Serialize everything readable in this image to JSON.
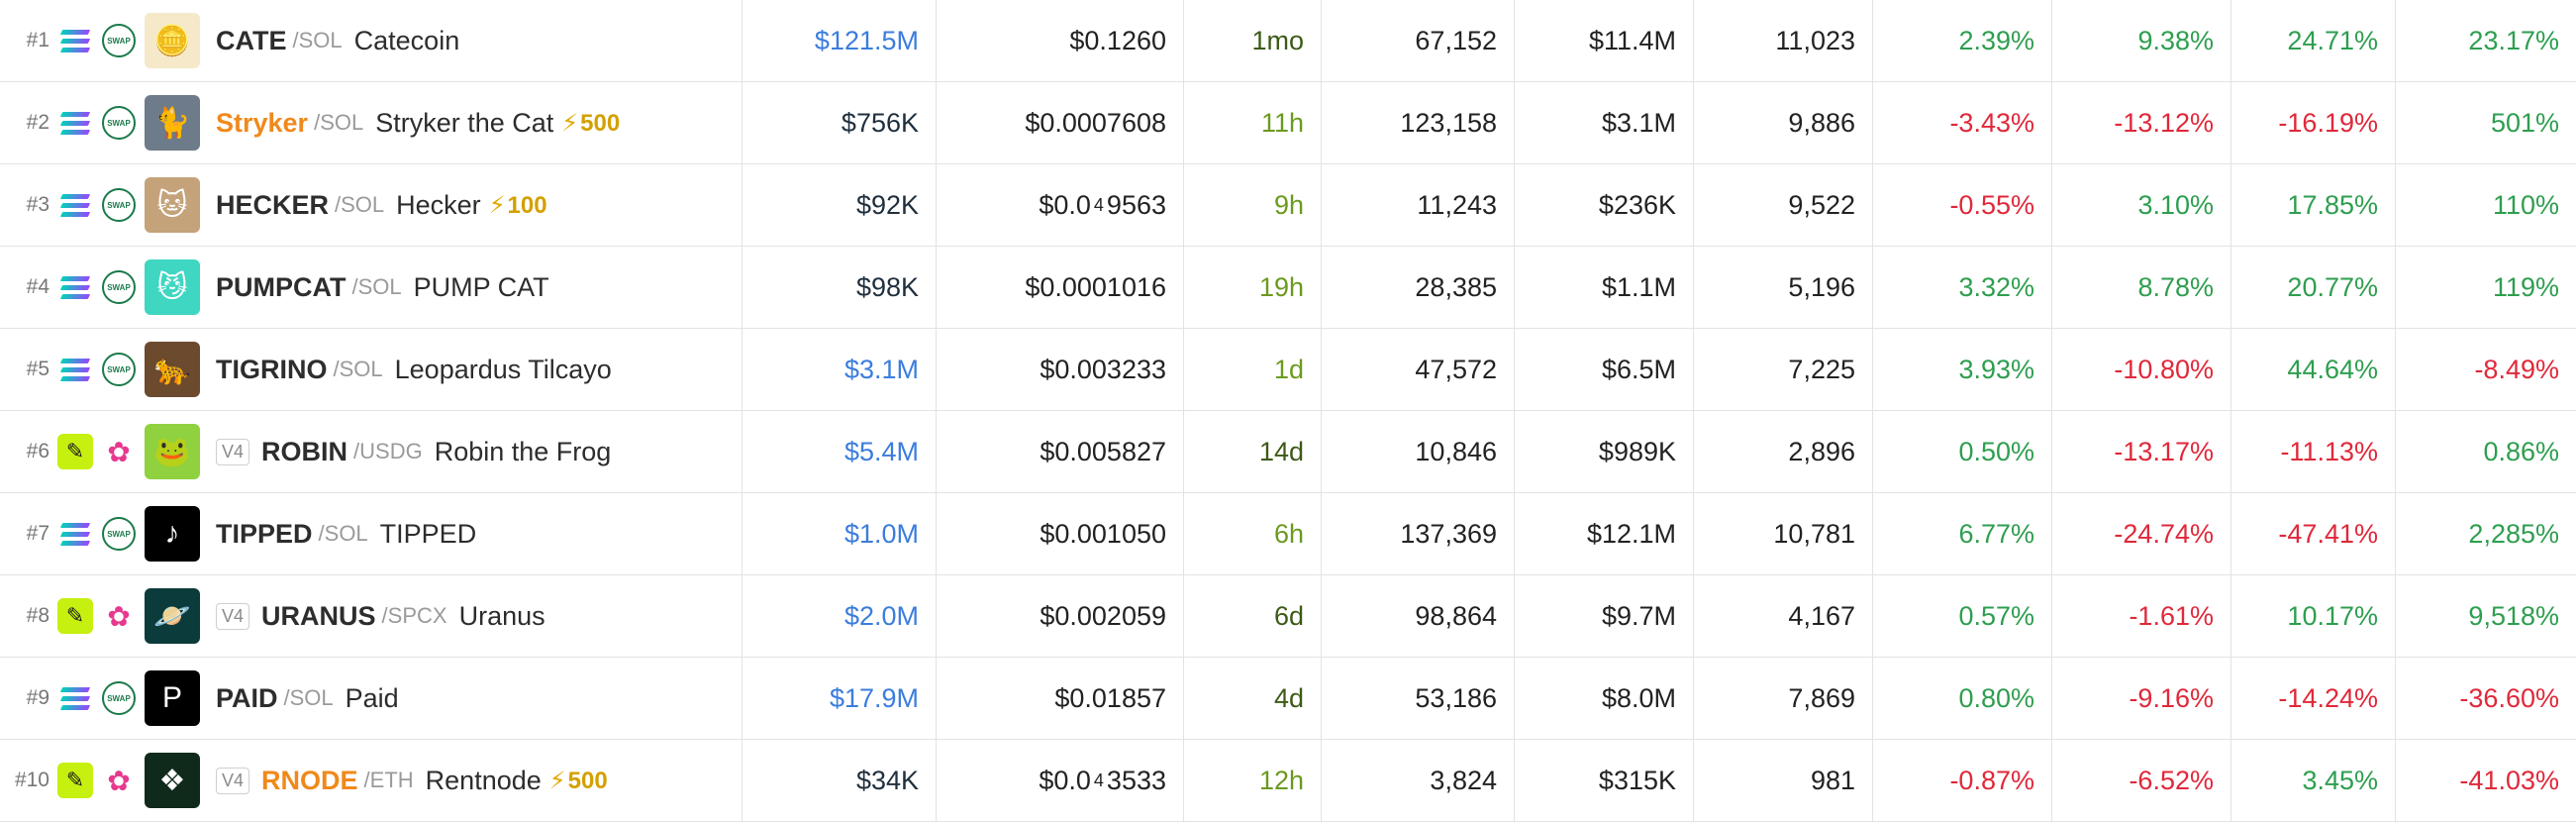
{
  "colors": {
    "up": "#2e9e4f",
    "down": "#e0283a",
    "mcap_blue": "#3b7ddd",
    "mcap_dark": "#1f2f3d",
    "boost": "#d4a000",
    "pump_green": "#c6f00f"
  },
  "rows": [
    {
      "rank": "#1",
      "chain_icon": "solana-icon",
      "dex_icon": "raydium-swap-icon",
      "v4": "",
      "symbol": "CATE",
      "symbol_color": "default",
      "quote": "/SOL",
      "name": "Catecoin",
      "boost": "",
      "mcap": "$121.5M",
      "mcap_color": "blue",
      "price": "$0.1260",
      "price_prefix": "",
      "price_sub": "",
      "price_tail": "",
      "age": "1mo",
      "age_color": "olive-dark",
      "txns": "67,152",
      "volume": "$11.4M",
      "makers": "11,023",
      "p5m": "2.39%",
      "p1h": "9.38%",
      "p6h": "24.71%",
      "p24h": "23.17%",
      "avatar_bg": "#f5e9c9",
      "avatar_glyph": "🪙"
    },
    {
      "rank": "#2",
      "chain_icon": "solana-icon",
      "dex_icon": "raydium-swap-icon",
      "v4": "",
      "symbol": "Stryker",
      "symbol_color": "orange",
      "quote": "/SOL",
      "name": "Stryker the Cat",
      "boost": "500",
      "mcap": "$756K",
      "mcap_color": "dark",
      "price": "$0.0007608",
      "price_prefix": "",
      "price_sub": "",
      "price_tail": "",
      "age": "11h",
      "age_color": "olive",
      "txns": "123,158",
      "volume": "$3.1M",
      "makers": "9,886",
      "p5m": "-3.43%",
      "p1h": "-13.12%",
      "p6h": "-16.19%",
      "p24h": "501%",
      "avatar_bg": "#6d7b8a",
      "avatar_glyph": "🐈"
    },
    {
      "rank": "#3",
      "chain_icon": "solana-icon",
      "dex_icon": "raydium-swap-icon",
      "v4": "",
      "symbol": "HECKER",
      "symbol_color": "default",
      "quote": "/SOL",
      "name": "Hecker",
      "boost": "100",
      "mcap": "$92K",
      "mcap_color": "dark",
      "price": "",
      "price_prefix": "$0.0",
      "price_sub": "4",
      "price_tail": "9563",
      "age": "9h",
      "age_color": "olive",
      "txns": "11,243",
      "volume": "$236K",
      "makers": "9,522",
      "p5m": "-0.55%",
      "p1h": "3.10%",
      "p6h": "17.85%",
      "p24h": "110%",
      "avatar_bg": "#c4a27a",
      "avatar_glyph": "🐱"
    },
    {
      "rank": "#4",
      "chain_icon": "solana-icon",
      "dex_icon": "raydium-swap-icon",
      "v4": "",
      "symbol": "PUMPCAT",
      "symbol_color": "default",
      "quote": "/SOL",
      "name": "PUMP CAT",
      "boost": "",
      "mcap": "$98K",
      "mcap_color": "dark",
      "price": "$0.0001016",
      "price_prefix": "",
      "price_sub": "",
      "price_tail": "",
      "age": "19h",
      "age_color": "olive",
      "txns": "28,385",
      "volume": "$1.1M",
      "makers": "5,196",
      "p5m": "3.32%",
      "p1h": "8.78%",
      "p6h": "20.77%",
      "p24h": "119%",
      "avatar_bg": "#3fd6c2",
      "avatar_glyph": "😼"
    },
    {
      "rank": "#5",
      "chain_icon": "solana-icon",
      "dex_icon": "raydium-swap-icon",
      "v4": "",
      "symbol": "TIGRINO",
      "symbol_color": "default",
      "quote": "/SOL",
      "name": "Leopardus Tilcayo",
      "boost": "",
      "mcap": "$3.1M",
      "mcap_color": "blue",
      "price": "$0.003233",
      "price_prefix": "",
      "price_sub": "",
      "price_tail": "",
      "age": "1d",
      "age_color": "olive",
      "txns": "47,572",
      "volume": "$6.5M",
      "makers": "7,225",
      "p5m": "3.93%",
      "p1h": "-10.80%",
      "p6h": "44.64%",
      "p24h": "-8.49%",
      "avatar_bg": "#6b4a2e",
      "avatar_glyph": "🐆"
    },
    {
      "rank": "#6",
      "chain_icon": "pumpfun-icon",
      "dex_icon": "fox-dex-icon",
      "v4": "V4",
      "symbol": "ROBIN",
      "symbol_color": "default",
      "quote": "/USDG",
      "name": "Robin the Frog",
      "boost": "",
      "mcap": "$5.4M",
      "mcap_color": "blue",
      "price": "$0.005827",
      "price_prefix": "",
      "price_sub": "",
      "price_tail": "",
      "age": "14d",
      "age_color": "olive-dark",
      "txns": "10,846",
      "volume": "$989K",
      "makers": "2,896",
      "p5m": "0.50%",
      "p1h": "-13.17%",
      "p6h": "-11.13%",
      "p24h": "0.86%",
      "avatar_bg": "#8fd13f",
      "avatar_glyph": "🐸"
    },
    {
      "rank": "#7",
      "chain_icon": "solana-icon",
      "dex_icon": "raydium-swap-icon",
      "v4": "",
      "symbol": "TIPPED",
      "symbol_color": "default",
      "quote": "/SOL",
      "name": "TIPPED",
      "boost": "",
      "mcap": "$1.0M",
      "mcap_color": "blue",
      "price": "$0.001050",
      "price_prefix": "",
      "price_sub": "",
      "price_tail": "",
      "age": "6h",
      "age_color": "olive",
      "txns": "137,369",
      "volume": "$12.1M",
      "makers": "10,781",
      "p5m": "6.77%",
      "p1h": "-24.74%",
      "p6h": "-47.41%",
      "p24h": "2,285%",
      "avatar_bg": "#000000",
      "avatar_glyph": "♪"
    },
    {
      "rank": "#8",
      "chain_icon": "pumpfun-icon",
      "dex_icon": "fox-dex-icon",
      "v4": "V4",
      "symbol": "URANUS",
      "symbol_color": "default",
      "quote": "/SPCX",
      "name": "Uranus",
      "boost": "",
      "mcap": "$2.0M",
      "mcap_color": "blue",
      "price": "$0.002059",
      "price_prefix": "",
      "price_sub": "",
      "price_tail": "",
      "age": "6d",
      "age_color": "olive-dark",
      "txns": "98,864",
      "volume": "$9.7M",
      "makers": "4,167",
      "p5m": "0.57%",
      "p1h": "-1.61%",
      "p6h": "10.17%",
      "p24h": "9,518%",
      "avatar_bg": "#0b3b3a",
      "avatar_glyph": "🪐"
    },
    {
      "rank": "#9",
      "chain_icon": "solana-icon",
      "dex_icon": "raydium-swap-icon",
      "v4": "",
      "symbol": "PAID",
      "symbol_color": "default",
      "quote": "/SOL",
      "name": "Paid",
      "boost": "",
      "mcap": "$17.9M",
      "mcap_color": "blue",
      "price": "$0.01857",
      "price_prefix": "",
      "price_sub": "",
      "price_tail": "",
      "age": "4d",
      "age_color": "olive-dark",
      "txns": "53,186",
      "volume": "$8.0M",
      "makers": "7,869",
      "p5m": "0.80%",
      "p1h": "-9.16%",
      "p6h": "-14.24%",
      "p24h": "-36.60%",
      "avatar_bg": "#000000",
      "avatar_glyph": "P"
    },
    {
      "rank": "#10",
      "chain_icon": "pumpfun-icon",
      "dex_icon": "fox-dex-icon",
      "v4": "V4",
      "symbol": "RNODE",
      "symbol_color": "orange",
      "quote": "/ETH",
      "name": "Rentnode",
      "boost": "500",
      "mcap": "$34K",
      "mcap_color": "dark",
      "price": "",
      "price_prefix": "$0.0",
      "price_sub": "4",
      "price_tail": "3533",
      "age": "12h",
      "age_color": "olive",
      "txns": "3,824",
      "volume": "$315K",
      "makers": "981",
      "p5m": "-0.87%",
      "p1h": "-6.52%",
      "p6h": "3.45%",
      "p24h": "-41.03%",
      "avatar_bg": "#0f2a1a",
      "avatar_glyph": "❖"
    }
  ]
}
